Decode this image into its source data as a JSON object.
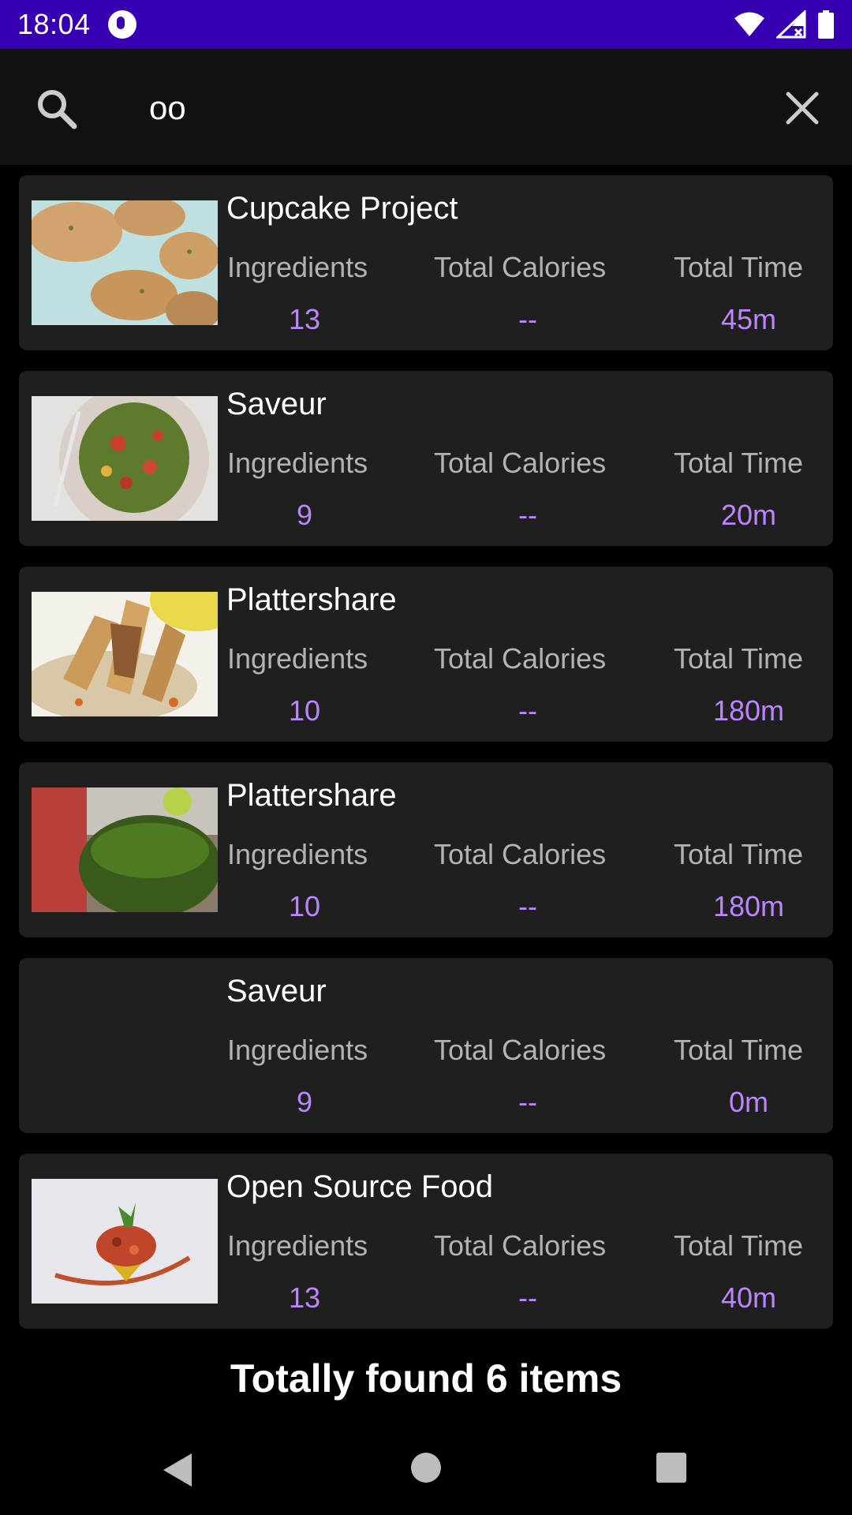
{
  "status_bar": {
    "time": "18:04"
  },
  "search": {
    "query": "oo",
    "placeholder": ""
  },
  "labels": {
    "ingredients": "Ingredients",
    "calories": "Total Calories",
    "time": "Total Time"
  },
  "recipes": [
    {
      "title": "Cupcake Project",
      "ingredients": "13",
      "calories": "--",
      "time": "45m",
      "image": "cookies"
    },
    {
      "title": "Saveur",
      "ingredients": "9",
      "calories": "--",
      "time": "20m",
      "image": "salad"
    },
    {
      "title": "Plattershare",
      "ingredients": "10",
      "calories": "--",
      "time": "180m",
      "image": "rolls"
    },
    {
      "title": "Plattershare",
      "ingredients": "10",
      "calories": "--",
      "time": "180m",
      "image": "green-drink"
    },
    {
      "title": "Saveur",
      "ingredients": "9",
      "calories": "--",
      "time": "0m",
      "image": ""
    },
    {
      "title": "Open Source Food",
      "ingredients": "13",
      "calories": "--",
      "time": "40m",
      "image": "tartare"
    }
  ],
  "footer": {
    "summary": "Totally found 6 items"
  },
  "colors": {
    "status_bar": "#3700b3",
    "accent": "#bb86fc",
    "card": "#1f1f1f",
    "background": "#000000"
  }
}
